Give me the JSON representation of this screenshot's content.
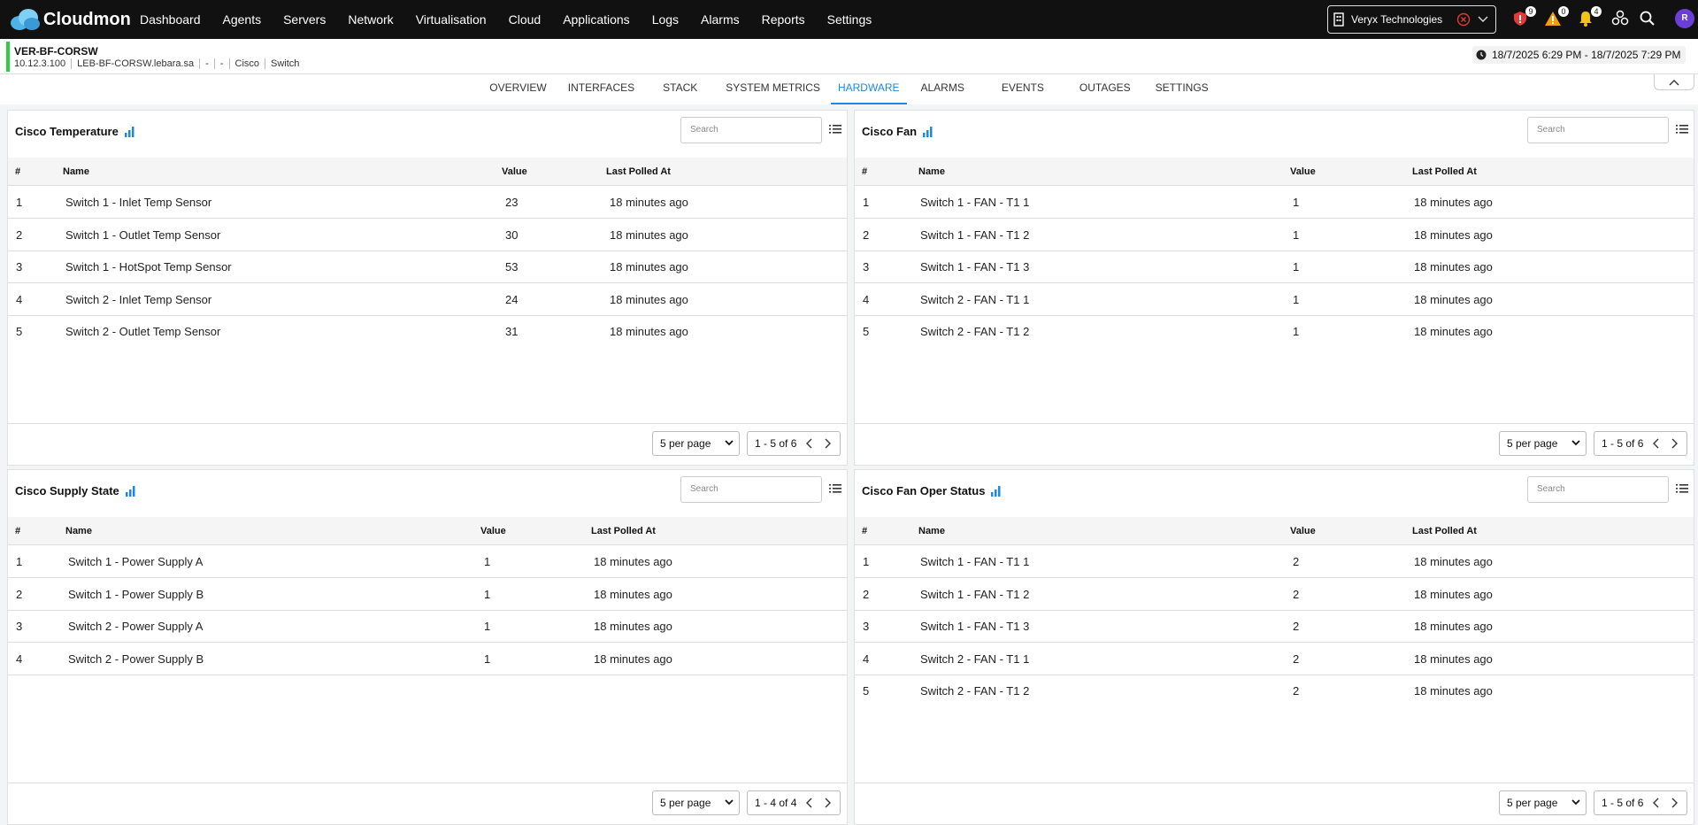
{
  "app": {
    "name": "Cloudmon"
  },
  "nav": [
    "Dashboard",
    "Agents",
    "Servers",
    "Network",
    "Virtualisation",
    "Cloud",
    "Applications",
    "Logs",
    "Alarms",
    "Reports",
    "Settings"
  ],
  "org": {
    "name": "Veryx Technologies"
  },
  "badges": {
    "critical": "9",
    "warning": "0",
    "notifications": "4"
  },
  "user": {
    "initial": "R"
  },
  "device": {
    "name": "VER-BF-CORSW",
    "ip": "10.12.3.100",
    "host": "LEB-BF-CORSW.lebara.sa",
    "f1": "-",
    "f2": "-",
    "vendor": "Cisco",
    "type": "Switch"
  },
  "timerange": "18/7/2025 6:29 PM - 18/7/2025 7:29 PM",
  "tabs": [
    "OVERVIEW",
    "INTERFACES",
    "STACK",
    "SYSTEM METRICS",
    "HARDWARE",
    "ALARMS",
    "EVENTS",
    "OUTAGES",
    "SETTINGS"
  ],
  "active_tab": "HARDWARE",
  "common": {
    "search_placeholder": "Search",
    "col_num": "#",
    "col_name": "Name",
    "col_value": "Value",
    "col_polled": "Last Polled At",
    "per_page": "5 per page"
  },
  "panels": [
    {
      "title": "Cisco Temperature",
      "pager": "1 - 5 of 6",
      "rows": [
        {
          "n": "1",
          "name": "Switch 1 - Inlet Temp Sensor",
          "value": "23",
          "polled": "18 minutes ago"
        },
        {
          "n": "2",
          "name": "Switch 1 - Outlet Temp Sensor",
          "value": "30",
          "polled": "18 minutes ago"
        },
        {
          "n": "3",
          "name": "Switch 1 - HotSpot Temp Sensor",
          "value": "53",
          "polled": "18 minutes ago"
        },
        {
          "n": "4",
          "name": "Switch 2 - Inlet Temp Sensor",
          "value": "24",
          "polled": "18 minutes ago"
        },
        {
          "n": "5",
          "name": "Switch 2 - Outlet Temp Sensor",
          "value": "31",
          "polled": "18 minutes ago"
        }
      ]
    },
    {
      "title": "Cisco Fan",
      "pager": "1 - 5 of 6",
      "rows": [
        {
          "n": "1",
          "name": "Switch 1 - FAN - T1 1",
          "value": "1",
          "polled": "18 minutes ago"
        },
        {
          "n": "2",
          "name": "Switch 1 - FAN - T1 2",
          "value": "1",
          "polled": "18 minutes ago"
        },
        {
          "n": "3",
          "name": "Switch 1 - FAN - T1 3",
          "value": "1",
          "polled": "18 minutes ago"
        },
        {
          "n": "4",
          "name": "Switch 2 - FAN - T1 1",
          "value": "1",
          "polled": "18 minutes ago"
        },
        {
          "n": "5",
          "name": "Switch 2 - FAN - T1 2",
          "value": "1",
          "polled": "18 minutes ago"
        }
      ]
    },
    {
      "title": "Cisco Supply State",
      "pager": "1 - 4 of 4",
      "rows": [
        {
          "n": "1",
          "name": "Switch 1 - Power Supply A",
          "value": "1",
          "polled": "18 minutes ago"
        },
        {
          "n": "2",
          "name": "Switch 1 - Power Supply B",
          "value": "1",
          "polled": "18 minutes ago"
        },
        {
          "n": "3",
          "name": "Switch 2 - Power Supply A",
          "value": "1",
          "polled": "18 minutes ago"
        },
        {
          "n": "4",
          "name": "Switch 2 - Power Supply B",
          "value": "1",
          "polled": "18 minutes ago"
        }
      ]
    },
    {
      "title": "Cisco Fan Oper Status",
      "pager": "1 - 5 of 6",
      "rows": [
        {
          "n": "1",
          "name": "Switch 1 - FAN - T1 1",
          "value": "2",
          "polled": "18 minutes ago"
        },
        {
          "n": "2",
          "name": "Switch 1 - FAN - T1 2",
          "value": "2",
          "polled": "18 minutes ago"
        },
        {
          "n": "3",
          "name": "Switch 1 - FAN - T1 3",
          "value": "2",
          "polled": "18 minutes ago"
        },
        {
          "n": "4",
          "name": "Switch 2 - FAN - T1 1",
          "value": "2",
          "polled": "18 minutes ago"
        },
        {
          "n": "5",
          "name": "Switch 2 - FAN - T1 2",
          "value": "2",
          "polled": "18 minutes ago"
        }
      ]
    }
  ],
  "colors": {
    "accent": "#1e88e5",
    "topbar": "#111111",
    "status_green": "#2ecc40",
    "critical": "#e53935",
    "warning": "#f39c12",
    "notify": "#f1c40f"
  }
}
